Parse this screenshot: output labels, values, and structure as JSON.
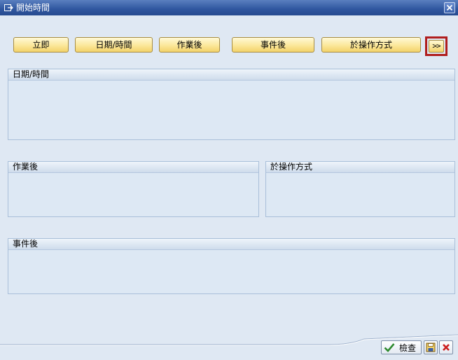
{
  "window": {
    "title": "開始時間",
    "icon": "window-icon",
    "close_icon": "close-icon"
  },
  "toolbar": {
    "immediate": "立即",
    "date_time": "日期/時間",
    "after_job": "作業後",
    "after_event": "事件後",
    "at_operation_mode": "於操作方式",
    "more": ">>"
  },
  "groups": {
    "date_time": "日期/時間",
    "after_job": "作業後",
    "operation_mode": "於操作方式",
    "after_event": "事件後"
  },
  "footer": {
    "check_label": "檢查",
    "save_icon": "save-icon",
    "cancel_icon": "cancel-icon"
  },
  "colors": {
    "titlebar": "#2f569f",
    "background": "#dfe8f3",
    "button": "#fbe79a",
    "highlight_border": "#b01d1d"
  }
}
